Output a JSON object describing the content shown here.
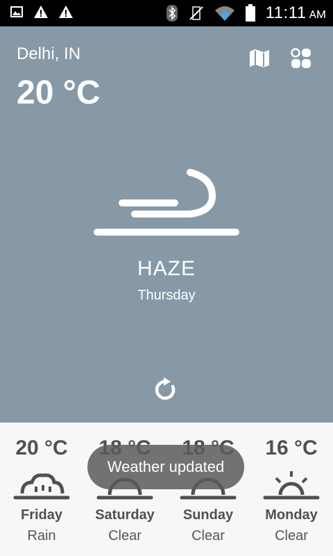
{
  "status_bar": {
    "time": "11:11",
    "ampm": "AM",
    "left_icons": [
      "image-icon",
      "warning-icon",
      "warning-icon"
    ],
    "right_icons": [
      "bluetooth-icon",
      "vibrate-off-icon",
      "wifi-icon",
      "battery-icon"
    ]
  },
  "current": {
    "location": "Delhi, IN",
    "temperature": "20 °C",
    "condition": "HAZE",
    "day": "Thursday",
    "icon": "haze-wind-icon"
  },
  "header_actions": {
    "map": "map-icon",
    "grid": "grid-icon",
    "refresh": "refresh-icon"
  },
  "forecast": [
    {
      "temp": "20 °C",
      "day": "Friday",
      "condition": "Rain",
      "icon": "rain-cloud-icon"
    },
    {
      "temp": "18 °C",
      "day": "Saturday",
      "condition": "Clear",
      "icon": "sunrise-icon"
    },
    {
      "temp": "18 °C",
      "day": "Sunday",
      "condition": "Clear",
      "icon": "sunrise-icon"
    },
    {
      "temp": "16 °C",
      "day": "Monday",
      "condition": "Clear",
      "icon": "sun-rays-icon"
    }
  ],
  "toast": {
    "message": "Weather updated"
  },
  "colors": {
    "main_bg": "#8799a7",
    "forecast_bg": "#f7f7f7",
    "status_bar_bg": "#000000",
    "text_dark": "#505050"
  }
}
